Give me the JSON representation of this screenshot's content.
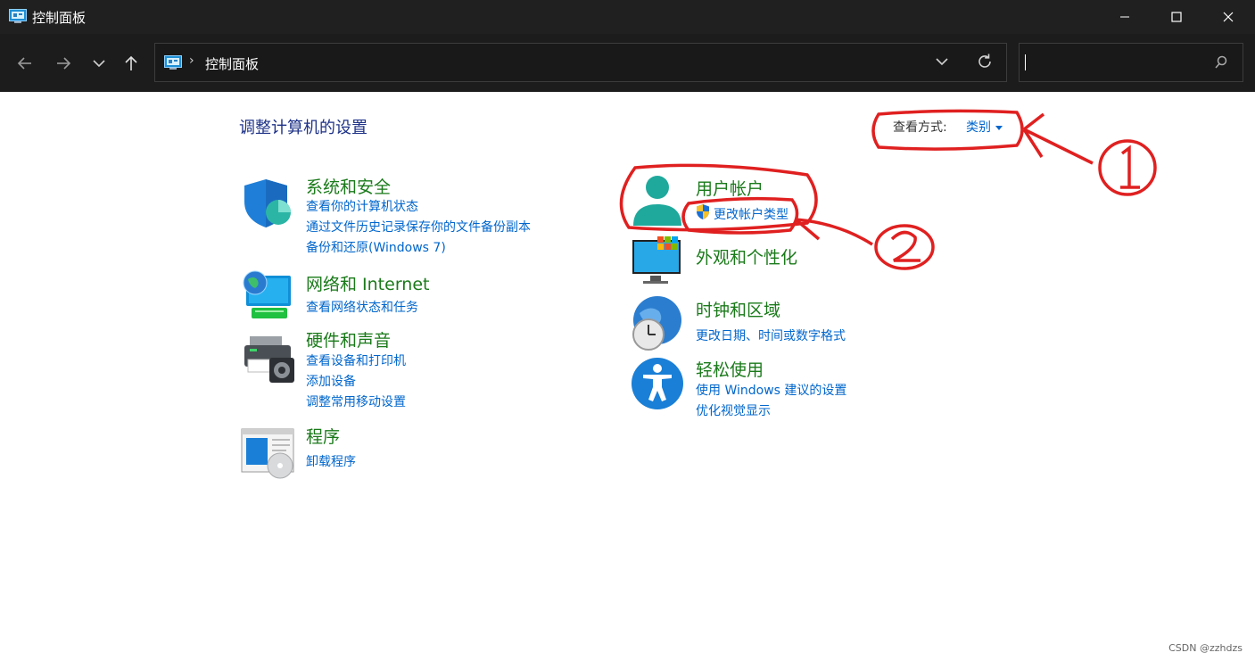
{
  "window": {
    "title": "控制面板"
  },
  "address": {
    "crumb": "控制面板"
  },
  "search": {
    "placeholder": ""
  },
  "page": {
    "heading": "调整计算机的设置",
    "view_by_label": "查看方式:",
    "view_by_value": "类别"
  },
  "categories": [
    {
      "title": "系统和安全",
      "links": [
        "查看你的计算机状态",
        "通过文件历史记录保存你的文件备份副本",
        "备份和还原(Windows 7)"
      ]
    },
    {
      "title": "网络和 Internet",
      "links": [
        "查看网络状态和任务"
      ]
    },
    {
      "title": "硬件和声音",
      "links": [
        "查看设备和打印机",
        "添加设备",
        "调整常用移动设置"
      ]
    },
    {
      "title": "程序",
      "links": [
        "卸载程序"
      ]
    },
    {
      "title": "用户帐户",
      "links": [
        "更改帐户类型"
      ]
    },
    {
      "title": "外观和个性化",
      "links": []
    },
    {
      "title": "时钟和区域",
      "links": [
        "更改日期、时间或数字格式"
      ]
    },
    {
      "title": "轻松使用",
      "links": [
        "使用 Windows 建议的设置",
        "优化视觉显示"
      ]
    }
  ],
  "watermark": "CSDN @zzhdzs",
  "colors": {
    "annotation": "#e02020",
    "link": "#0066cc",
    "category": "#1a7a1a",
    "heading": "#1e3287"
  }
}
